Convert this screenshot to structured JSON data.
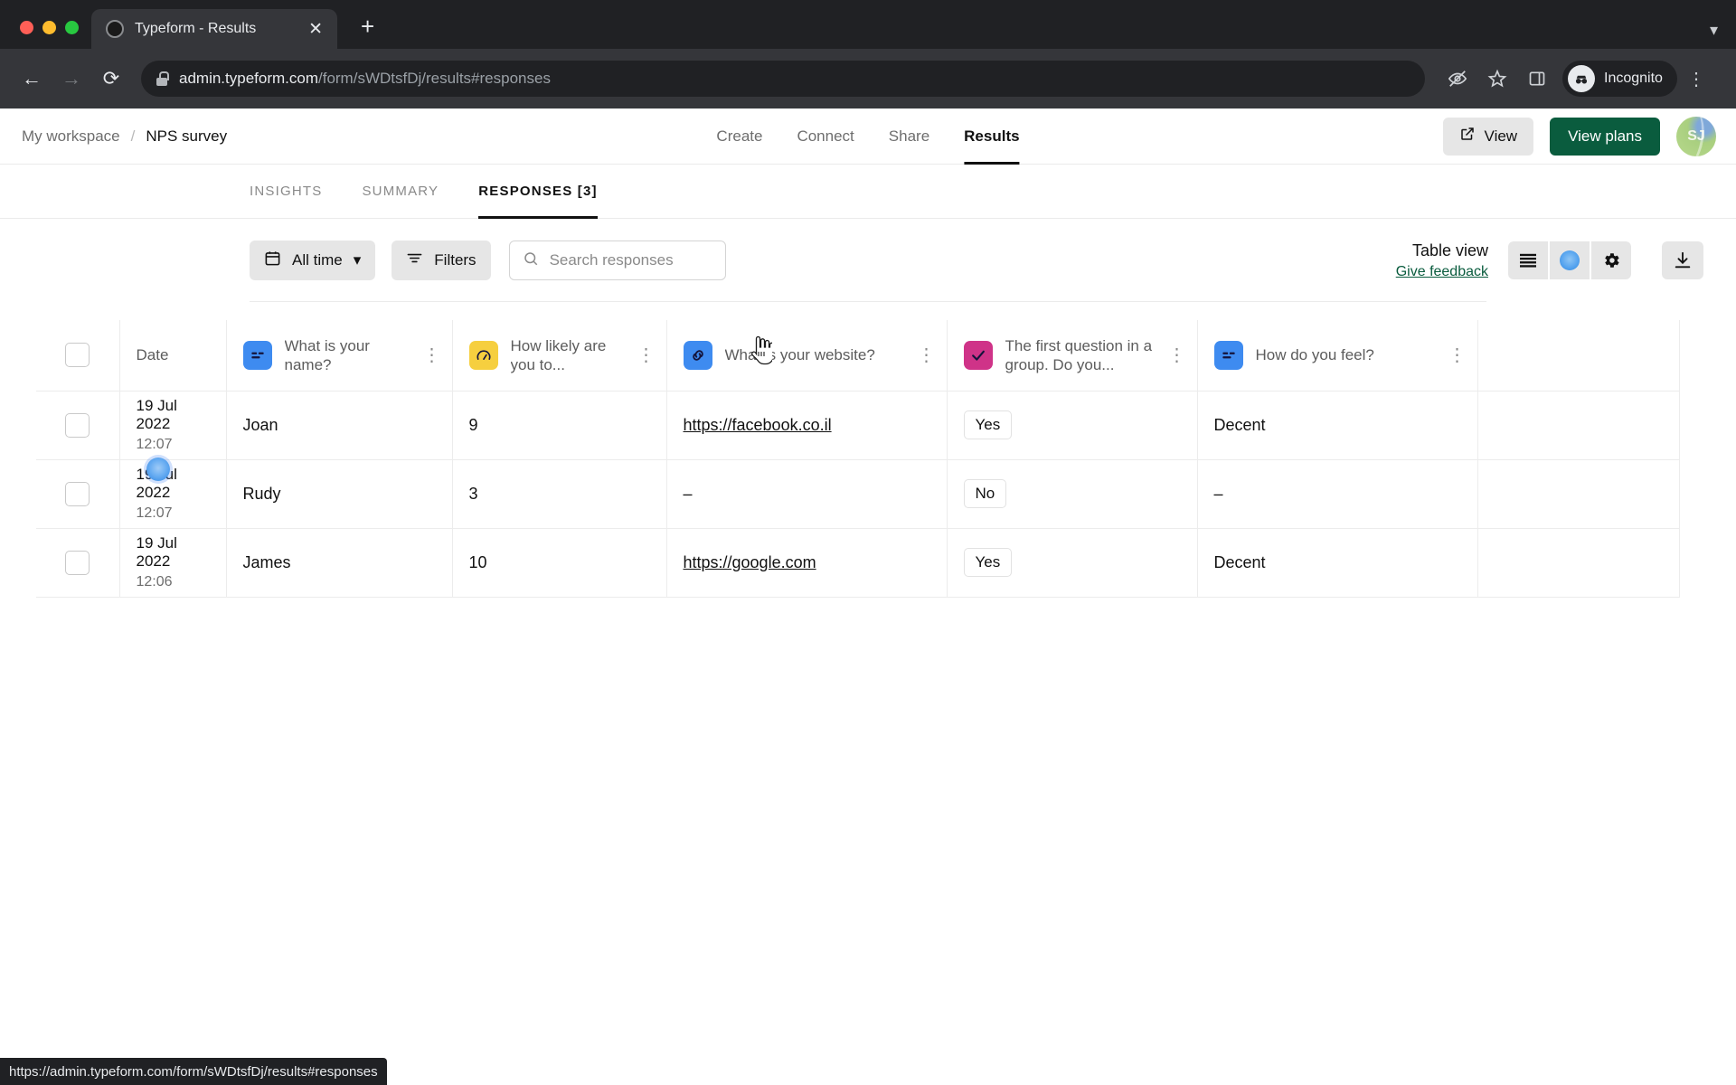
{
  "browser": {
    "tab": {
      "title": "Typeform - Results",
      "favicon_icon": "circle-favicon",
      "close_icon": "close-icon"
    },
    "new_tab_icon": "plus-icon",
    "tab_list_icon": "chevron-down-icon",
    "back_icon": "arrow-left-icon",
    "forward_icon": "arrow-right-icon",
    "reload_icon": "reload-icon",
    "lock_icon": "lock-icon",
    "url_host": "admin.typeform.com",
    "url_path": "/form/sWDtsfDj/results#responses",
    "eye_off_icon": "eye-off-icon",
    "star_icon": "star-icon",
    "sidepanel_icon": "side-panel-icon",
    "incognito_label": "Incognito",
    "incognito_icon": "incognito-icon",
    "menu_icon": "kebab-menu-icon",
    "status_url": "https://admin.typeform.com/form/sWDtsfDj/results#responses"
  },
  "header": {
    "breadcrumb": {
      "workspace": "My workspace",
      "separator": "/",
      "form": "NPS survey"
    },
    "nav": [
      {
        "label": "Create",
        "active": false
      },
      {
        "label": "Connect",
        "active": false
      },
      {
        "label": "Share",
        "active": false
      },
      {
        "label": "Results",
        "active": true
      }
    ],
    "view_button": {
      "label": "View",
      "icon": "external-link-icon"
    },
    "plans_button": {
      "label": "View plans",
      "color": "#0a5c3e"
    },
    "avatar_initials": "SJ"
  },
  "subnav": [
    {
      "label": "INSIGHTS",
      "active": false
    },
    {
      "label": "SUMMARY",
      "active": false
    },
    {
      "label": "RESPONSES [3]",
      "active": true
    }
  ],
  "toolbar": {
    "date_filter": {
      "label": "All time",
      "icon": "calendar-icon",
      "chevron": "chevron-down-icon"
    },
    "filters": {
      "label": "Filters",
      "icon": "filter-icon"
    },
    "search": {
      "placeholder": "Search responses",
      "value": "",
      "icon": "search-icon"
    },
    "view_title": "Table view",
    "feedback_link": "Give feedback",
    "segment_icons": [
      "list-view-icon",
      "card-view-icon",
      "gear-icon"
    ],
    "download_icon": "download-icon",
    "accent_blue": "#2f86e4"
  },
  "table": {
    "select_all_checkbox": "select-all-checkbox",
    "columns": [
      {
        "key": "date",
        "label": "Date",
        "type": "date"
      },
      {
        "key": "name",
        "label": "What is your name?",
        "icon": "short-text-icon",
        "icon_color": "#3e8bf0",
        "kebab": "column-menu-icon"
      },
      {
        "key": "nps",
        "label": "How likely are you to...",
        "icon": "opinion-scale-icon",
        "icon_color": "#f6cf3f",
        "kebab": "column-menu-icon"
      },
      {
        "key": "website",
        "label": "What is your website?",
        "icon": "website-icon",
        "icon_color": "#3e8bf0",
        "kebab": "column-menu-icon"
      },
      {
        "key": "group",
        "label": "The first question in a group. Do you...",
        "icon": "yes-no-icon",
        "icon_color": "#cf3388",
        "kebab": "column-menu-icon"
      },
      {
        "key": "feel",
        "label": "How do you feel?",
        "icon": "short-text-icon",
        "icon_color": "#3e8bf0",
        "kebab": "column-menu-icon"
      }
    ],
    "rows": [
      {
        "date": "19 Jul 2022",
        "time": "12:07",
        "name": "Joan",
        "nps": "9",
        "website": "https://facebook.co.il",
        "website_is_link": true,
        "group": "Yes",
        "feel": "Decent"
      },
      {
        "date": "19 Jul 2022",
        "time": "12:07",
        "name": "Rudy",
        "nps": "3",
        "website": "–",
        "website_is_link": false,
        "group": "No",
        "feel": "–"
      },
      {
        "date": "19 Jul 2022",
        "time": "12:06",
        "name": "James",
        "nps": "10",
        "website": "https://google.com",
        "website_is_link": true,
        "group": "Yes",
        "feel": "Decent"
      }
    ]
  }
}
